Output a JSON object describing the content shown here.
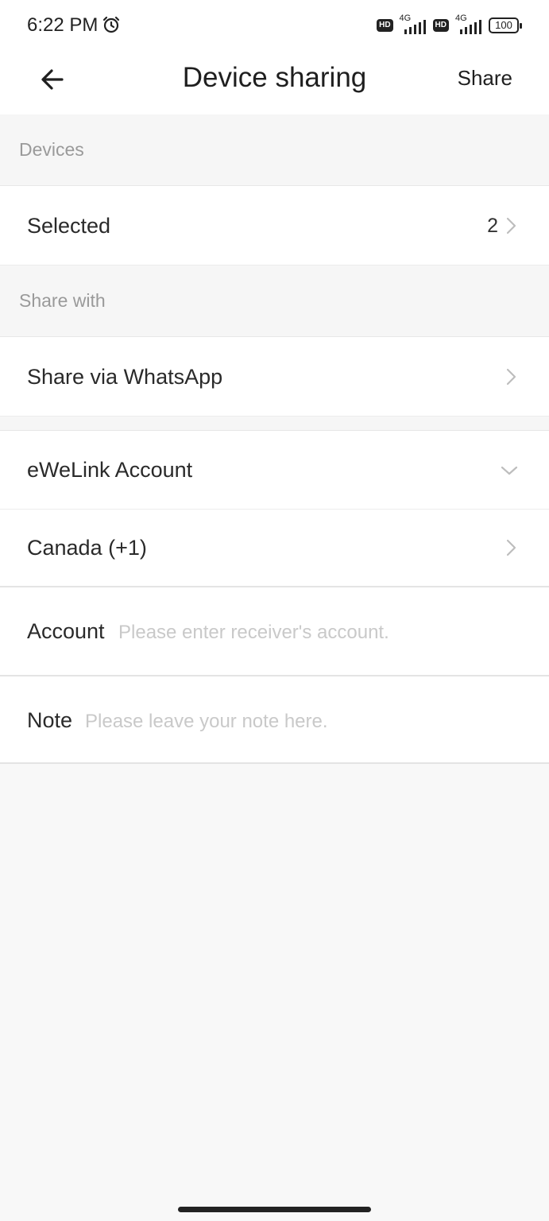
{
  "status_bar": {
    "time": "6:22 PM",
    "sim1": {
      "badge": "HD",
      "network": "4G"
    },
    "sim2": {
      "badge": "HD",
      "network": "4G"
    },
    "battery": "100",
    "icons": [
      "alarm-icon",
      "signal-icon",
      "battery-icon"
    ]
  },
  "header": {
    "title": "Device sharing",
    "share_label": "Share",
    "back_icon": "arrow-left-icon"
  },
  "sections": {
    "devices_header": "Devices",
    "share_with_header": "Share with"
  },
  "devices": {
    "selected_label": "Selected",
    "selected_count": "2"
  },
  "share_with": {
    "whatsapp_label": "Share via WhatsApp",
    "method_label": "eWeLink Account",
    "country_label": "Canada (+1)",
    "account_label": "Account",
    "account_placeholder": "Please enter receiver's account.",
    "note_label": "Note",
    "note_placeholder": "Please leave your note here."
  },
  "colors": {
    "background": "#f8f8f8",
    "section_text": "#9a9a9a",
    "placeholder_text": "#c9c9c9"
  }
}
